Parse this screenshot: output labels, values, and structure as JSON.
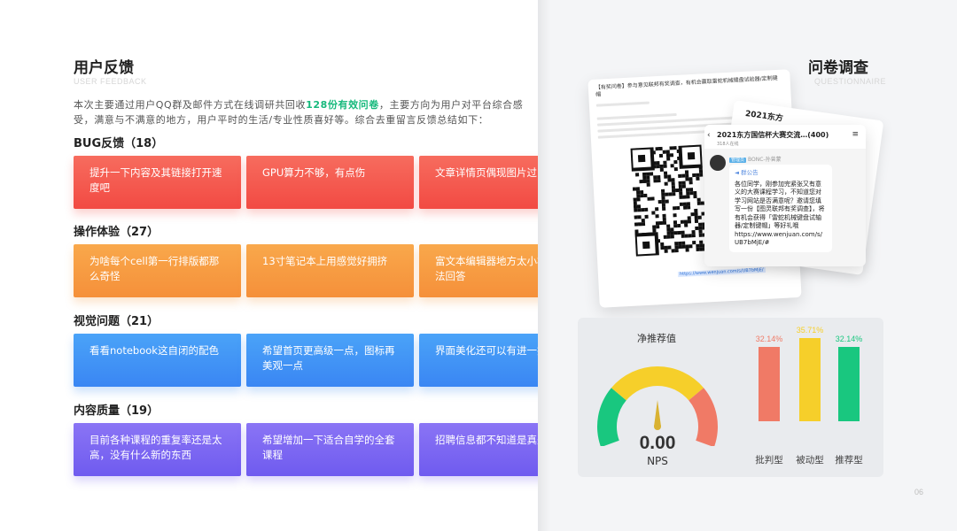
{
  "feedback": {
    "title": "用户反馈",
    "subtitle": "USER FEEDBACK",
    "intro_before": "本次主要通过用户QQ群及邮件方式在线调研共回收",
    "intro_highlight": "128份有效问卷",
    "intro_after": "，主要方向为用户对平台综合感受，满意与不满意的地方，用户平时的生活/专业性质喜好等。综合去重留言反馈总结如下：",
    "categories": [
      {
        "label": "BUG反馈（18）",
        "cards": [
          "提升一下内容及其链接打开速度吧",
          "GPU算力不够，有点伤",
          "文章详情页偶现图片过"
        ]
      },
      {
        "label": "操作体验（27）",
        "cards": [
          "为啥每个cell第一行排版都那么奇怪",
          "13寸笔记本上用感觉好拥挤",
          "富文本编辑器地方太小根本没法回答"
        ]
      },
      {
        "label": "视觉问题（21）",
        "cards": [
          "看看notebook这自闭的配色",
          "希望首页更高级一点，图标再美观一点",
          "界面美化还可以有进一提升"
        ]
      },
      {
        "label": "内容质量（19）",
        "cards": [
          "目前各种课程的重复率还是太高，没有什么新的东西",
          "希望增加一下适合自学的全套课程",
          "招聘信息都不知道是真是假的"
        ]
      }
    ]
  },
  "survey": {
    "title": "问卷调查",
    "subtitle": "QUESTIONNAIRE",
    "doc_header": "【有奖问卷】参与意见联邦有奖调查，有机会赢取雷蛇机械键盘试验器/定制键帽",
    "doc_link": "https://www.wenjuan.com/s/UB7bMjE/",
    "back_card_title": "2021东方",
    "chat_title": "2021东方国信杯大赛交流…(400)",
    "chat_online": "318人在线",
    "chat_badge": "管理员",
    "chat_sender": "BONC-孙曾蒙",
    "chat_notice": "群公告",
    "chat_message": "各位同学，刚参加完紧张又有意义的大赛课程学习，不知道您对学习网站是否满意呢？邀请您填写一份【图灵联邦有奖调查】，将有机会获得「雷蛇机械键盘试轴器/定制键帽」等好礼哦",
    "chat_url": "https://www.wenjuan.com/s/UB7bMjE/#"
  },
  "nps": {
    "title": "净推荐值",
    "value": "0.00",
    "label": "NPS",
    "needle_value": 0,
    "colors": {
      "detractor": "#f07a66",
      "passive": "#f6cf2a",
      "promoter": "#19c77f"
    }
  },
  "chart_data": {
    "type": "bar",
    "categories": [
      "批判型",
      "被动型",
      "推荐型"
    ],
    "values": [
      32.14,
      35.71,
      32.14
    ],
    "labels": [
      "32.14%",
      "35.71%",
      "32.14%"
    ],
    "colors": [
      "#f07a66",
      "#f6cf2a",
      "#19c77f"
    ],
    "ylim": [
      0,
      40
    ]
  },
  "page_number": "06"
}
